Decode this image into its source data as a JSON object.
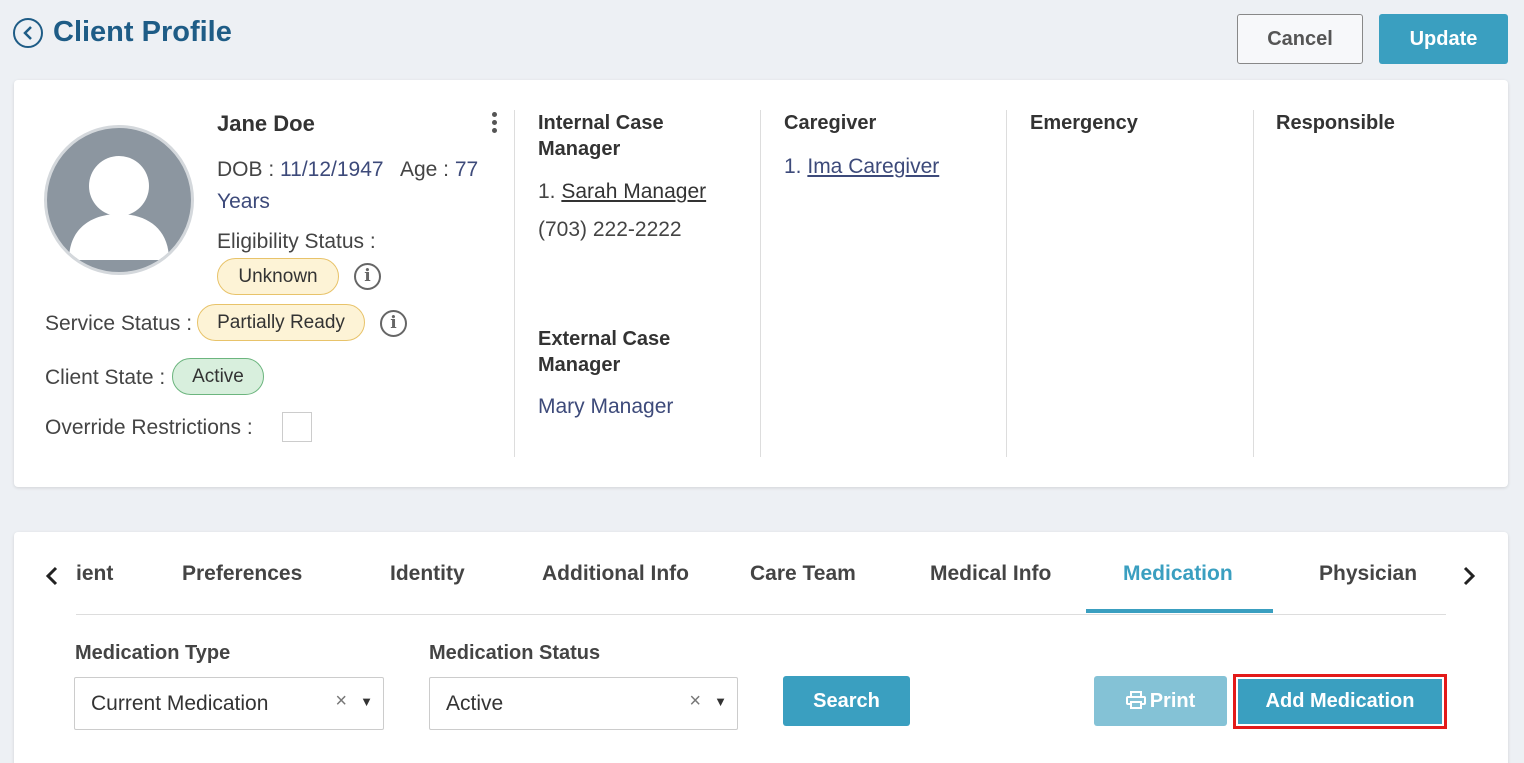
{
  "header": {
    "title": "Client Profile",
    "cancel_label": "Cancel",
    "update_label": "Update"
  },
  "profile": {
    "name": "Jane Doe",
    "dob_label": "DOB :",
    "dob": "11/12/1947",
    "age_label": "Age :",
    "age": "77",
    "age_unit": "Years",
    "eligibility_label": "Eligibility Status :",
    "eligibility_value": "Unknown",
    "service_label": "Service Status :",
    "service_value": "Partially Ready",
    "state_label": "Client State :",
    "state_value": "Active",
    "override_label": "Override Restrictions :",
    "override_checked": false
  },
  "columns": {
    "internal_cm": {
      "heading_line1": "Internal Case",
      "heading_line2": "Manager",
      "number": "1.",
      "name": "Sarah Manager",
      "phone": "(703) 222-2222"
    },
    "external_cm": {
      "heading_line1": "External Case",
      "heading_line2": "Manager",
      "name": "Mary Manager"
    },
    "caregiver": {
      "heading": "Caregiver",
      "number": "1.",
      "name": "Ima Caregiver"
    },
    "emergency": {
      "heading": "Emergency"
    },
    "responsible": {
      "heading": "Responsible"
    }
  },
  "tabs": [
    {
      "label": "ient"
    },
    {
      "label": "Preferences"
    },
    {
      "label": "Identity"
    },
    {
      "label": "Additional Info"
    },
    {
      "label": "Care Team"
    },
    {
      "label": "Medical Info"
    },
    {
      "label": "Medication",
      "active": true
    },
    {
      "label": "Physician"
    }
  ],
  "filters": {
    "medication_type_label": "Medication Type",
    "medication_type_value": "Current Medication",
    "medication_status_label": "Medication Status",
    "medication_status_value": "Active",
    "clear_glyph": "×",
    "caret_glyph": "▼"
  },
  "actions": {
    "search_label": "Search",
    "print_label": "Print",
    "add_label": "Add Medication"
  },
  "colors": {
    "accent": "#3a9fc0",
    "title": "#1e5c86",
    "highlight_border": "#e31a1a"
  }
}
